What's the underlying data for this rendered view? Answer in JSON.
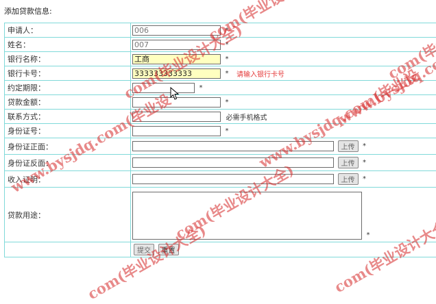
{
  "page_title": "添加贷款信息:",
  "fields": {
    "applicant": {
      "label": "申请人：",
      "value": "006",
      "required": "*"
    },
    "name": {
      "label": "姓名：",
      "value": "007",
      "required": "*"
    },
    "bank_name": {
      "label": "银行名称：",
      "value": "工商",
      "required": "*"
    },
    "card_no": {
      "label": "银行卡号：",
      "value": "333333333333",
      "required": "*",
      "error": "请输入银行卡号"
    },
    "term": {
      "label": "约定期限：",
      "value": "",
      "required": "*"
    },
    "amount": {
      "label": "贷款金额：",
      "value": "",
      "required": "*"
    },
    "contact": {
      "label": "联系方式：",
      "value": "",
      "hint": "必需手机格式"
    },
    "id_no": {
      "label": "身份证号：",
      "value": "",
      "required": "*"
    },
    "id_front": {
      "label": "身份证正面：",
      "value": "",
      "upload_label": "上传",
      "required": "*"
    },
    "id_back": {
      "label": "身份证反面：",
      "value": "",
      "upload_label": "上传",
      "required": "*"
    },
    "income": {
      "label": "收入证明：",
      "value": "",
      "upload_label": "上传",
      "required": "*"
    },
    "purpose": {
      "label": "贷款用途：",
      "value": "",
      "required": "*"
    }
  },
  "actions": {
    "submit_label": "提交",
    "reset_label": "重置"
  },
  "watermarks": {
    "a": "com(毕业设计大全)",
    "b": "com(毕业设计大全)",
    "c": "www.bysjdq.com(毕业设",
    "d": "www.bysjdq.com(毕业设",
    "e": "www.bysjdq.com(毕业设计大全)",
    "f": "com(毕业设计大全)",
    "g": "com(毕业设计大全)",
    "h": "com(毕业设计大全)",
    "i": "com(毕业设"
  },
  "colors": {
    "border": "#7fd9d9",
    "highlight": "#ffffc0",
    "error": "#e53b3b",
    "watermark": "#d62828"
  }
}
